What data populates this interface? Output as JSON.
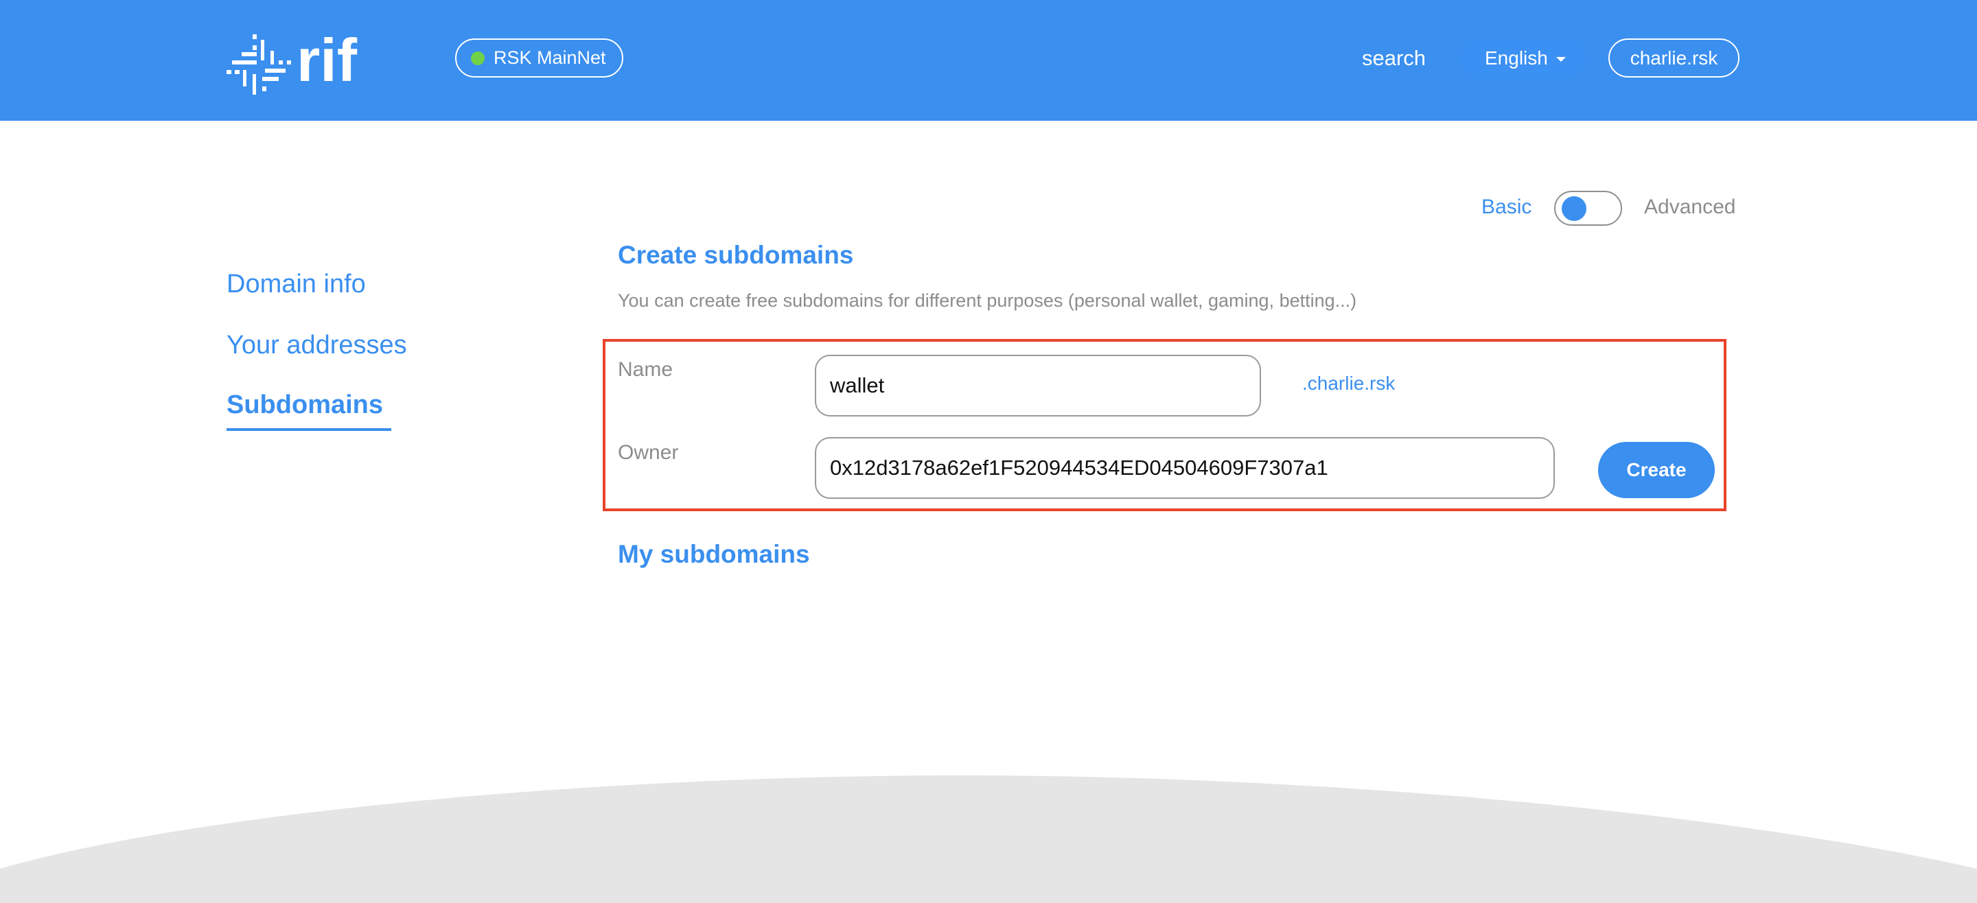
{
  "header": {
    "logo_text": "rif",
    "network": {
      "label": "RSK MainNet",
      "status_color": "#6FD148"
    },
    "nav": {
      "search_label": "search",
      "language_label": "English",
      "account_label": "charlie.rsk"
    },
    "brand_color": "#3A8FEF"
  },
  "mode_toggle": {
    "basic_label": "Basic",
    "advanced_label": "Advanced",
    "selected": "Basic"
  },
  "sidebar": {
    "items": [
      {
        "label": "Domain info",
        "active": false
      },
      {
        "label": "Your addresses",
        "active": false
      },
      {
        "label": "Subdomains",
        "active": true
      }
    ]
  },
  "main": {
    "create_section": {
      "title": "Create subdomains",
      "description": "You can create free subdomains for different purposes (personal wallet, gaming, betting...)",
      "name_label": "Name",
      "name_value": "wallet",
      "domain_suffix": ".charlie.rsk",
      "owner_label": "Owner",
      "owner_value": "0x12d3178a62ef1F520944534ED04504609F7307a1",
      "create_label": "Create",
      "highlight_color": "#E8442B"
    },
    "my_subdomains_title": "My subdomains"
  }
}
